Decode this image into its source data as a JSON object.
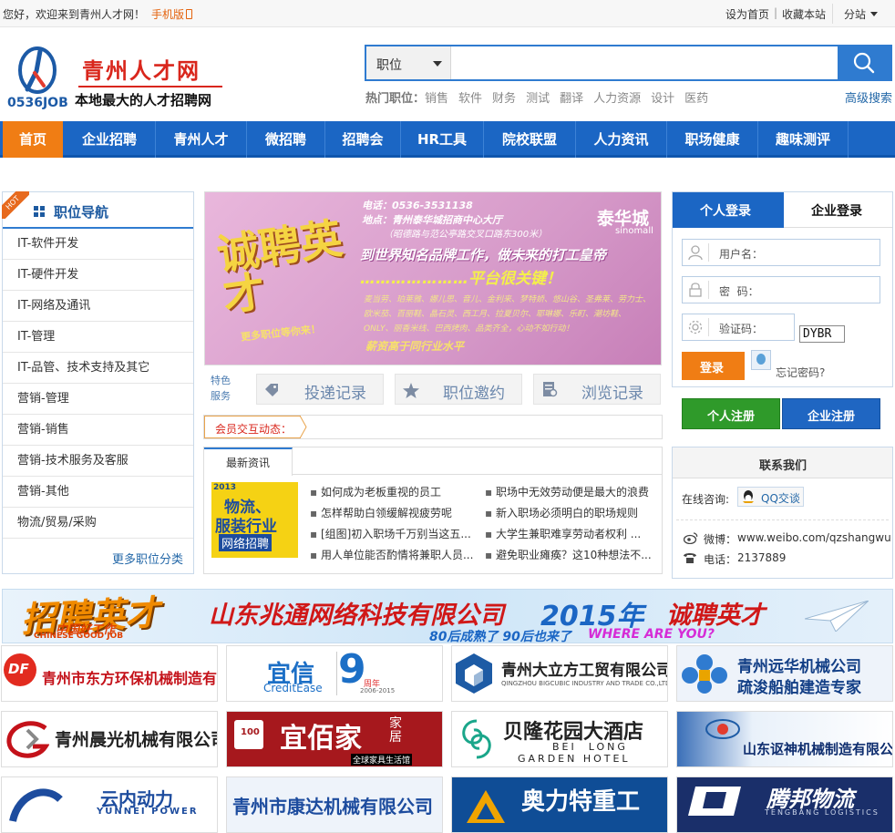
{
  "topbar": {
    "greeting": "您好，欢迎来到青州人才网！",
    "mobile": "手机版",
    "set_home": "设为首页",
    "divider": "|",
    "bookmark": "收藏本站",
    "substation": "分站"
  },
  "logo": {
    "brand": "青州人才网",
    "domain_mark": "0536JOB",
    "slogan": "本地最大的人才招聘网"
  },
  "search": {
    "category": "职位",
    "placeholder": "",
    "hot_label": "热门职位：",
    "hot_terms": [
      "销售",
      "软件",
      "财务",
      "测试",
      "翻译",
      "人力资源",
      "设计",
      "医药"
    ],
    "advanced": "高级搜索"
  },
  "nav": [
    "首页",
    "企业招聘",
    "青州人才",
    "微招聘",
    "招聘会",
    "HR工具",
    "院校联盟",
    "人力资讯",
    "职场健康",
    "趣味测评"
  ],
  "category_nav": {
    "badge": "HOT",
    "title": "职位导航",
    "items": [
      "IT-软件开发",
      "IT-硬件开发",
      "IT-网络及通讯",
      "IT-管理",
      "IT-品管、技术支持及其它",
      "营销-管理",
      "营销-销售",
      "营销-技术服务及客服",
      "营销-其他",
      "物流/贸易/采购"
    ],
    "more": "更多职位分类"
  },
  "banner": {
    "phone": "电话：0536-3531138",
    "address": "地点：青州泰华城招商中心大厅",
    "address2": "（昭德路与范公亭路交叉口路东300米）",
    "brand": "泰华城",
    "brand_en": "sinomall",
    "headline": "诚聘英才",
    "line1": "到世界知名品牌工作，做未来的打工皇帝",
    "line2": "…………………平台很关键！",
    "brands": "麦当劳、珀莱雅、娜儿思、音儿、金利来、梦特娇、悠山谷、圣弗莱、劳力士、欧米茄、百丽鞋、晶石灵、西工月、拉夏贝尔、耶琳娜、乐町、潮坊鞋、ONLY、丽香米线、巴西烤肉、品类齐全，心动不如行动！",
    "salary": "薪资高于同行业水平",
    "more_jobs": "更多职位等你来！"
  },
  "services": {
    "label_a": "特色",
    "label_b": "服务",
    "items": [
      "投递记录",
      "职位邀约",
      "浏览记录"
    ]
  },
  "ticker": {
    "label": "会员交互动态："
  },
  "news": {
    "tab": "最新资讯",
    "ad_text_1": "物流、",
    "ad_text_2": "服装行业",
    "ad_text_3": "网络招聘",
    "ad_year": "2013",
    "col1": [
      "如何成为老板重视的员工",
      "怎样帮助白领缓解视疲劳呢",
      "[组图]初入职场千万别当这五...",
      "用人单位能否酌情将兼职人员..."
    ],
    "col2": [
      "职场中无效劳动便是最大的浪费",
      "新入职场必须明白的职场规则",
      "大学生兼职难享劳动者权利 ...",
      "避免职业瘫痪？这10种想法不..."
    ]
  },
  "login": {
    "tab_personal": "个人登录",
    "tab_company": "企业登录",
    "username_ph": "用户名：",
    "password_ph": "密  码：",
    "captcha_ph": "验证码：",
    "captcha_value": "DYBR",
    "login_btn": "登录",
    "forgot": "忘记密码?",
    "reg_personal": "个人注册",
    "reg_company": "企业注册"
  },
  "contact": {
    "title": "联系我们",
    "online_label": "在线咨询:",
    "qq_btn": "QQ交谈",
    "weibo_label": "微博：",
    "weibo_value": "www.weibo.com/qzshangwu",
    "phone_label": "电话：",
    "phone_value": "2137889"
  },
  "wide_ad": {
    "left_big": "招聘英才",
    "left_sub": "中国好工作",
    "left_en": "CHINESE GOOD JOB",
    "company": "山东兆通网络科技有限公司",
    "year": "2015年",
    "tail": "诚聘英才",
    "sub": "80后成熟了  90后也来了",
    "sub_en": "WHERE ARE YOU?"
  },
  "companies": [
    {
      "name": "青州市东方环保机械制造有限公司",
      "mark": "DF"
    },
    {
      "name": "宜信",
      "sub": "CreditEase",
      "years": "9",
      "years_sub": "周年",
      "years_range": "2006-2015"
    },
    {
      "name": "青州大立方工贸有限公司",
      "sub": "QINGZHOU BIGCUBIC INDUSTRY AND TRADE CO.,LTD."
    },
    {
      "name": "青州远华机械公司",
      "sub": "疏浚船舶建造专家"
    },
    {
      "name": "青州晨光机械有限公司"
    },
    {
      "name": "宜佰家",
      "tag": "家居",
      "sub": "全球家具生活馆",
      "badge": "100"
    },
    {
      "name": "贝隆花园大酒店",
      "en1": "BEI  LONG",
      "en2": "GARDEN HOTEL"
    },
    {
      "name": "山东讴神机械制造有限公司"
    },
    {
      "name": "云内动力",
      "sub": "YUNNEI POWER"
    },
    {
      "name": "青州市康达机械有限公司"
    },
    {
      "name": "奥力特重工"
    },
    {
      "name": "腾邦物流",
      "sub": "TENGBANG LOGISTICS"
    }
  ],
  "colors": {
    "brand_blue": "#1b66c4",
    "accent_orange": "#f07d14",
    "logo_red": "#d9261c",
    "register_green": "#2f9a2a",
    "register_blue": "#1f66c2"
  }
}
